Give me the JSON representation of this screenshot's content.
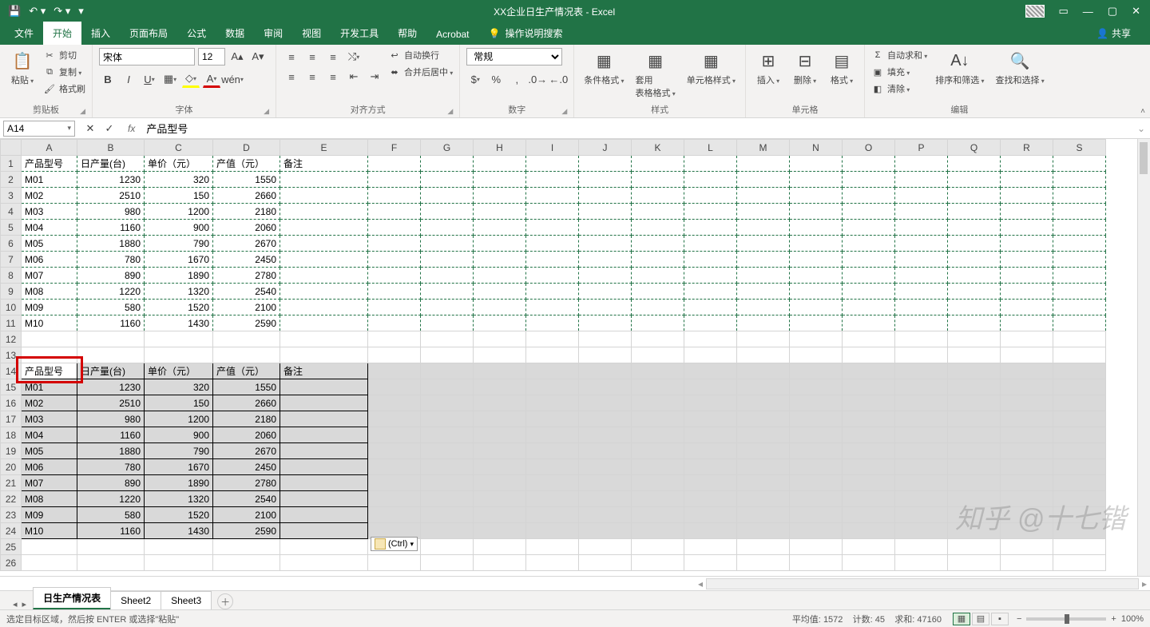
{
  "titlebar": {
    "title": "XX企业日生产情况表 - Excel",
    "qat": {
      "save": "💾",
      "undo_dd": "↶ ▾",
      "redo_dd": "↷ ▾",
      "more": "▾"
    },
    "win": {
      "ribbonopts": "▭",
      "min": "—",
      "max": "▢",
      "close": "✕"
    }
  },
  "tabs": {
    "file": "文件",
    "home": "开始",
    "insert": "插入",
    "layout": "页面布局",
    "formula": "公式",
    "data": "数据",
    "review": "审阅",
    "view": "视图",
    "dev": "开发工具",
    "help": "帮助",
    "acrobat": "Acrobat",
    "tellme": "操作说明搜索",
    "share": "共享"
  },
  "ribbon": {
    "clipboard": {
      "label": "剪贴板",
      "paste": "粘贴",
      "cut": "剪切",
      "copy": "复制",
      "fmtpainter": "格式刷"
    },
    "font": {
      "label": "字体",
      "name": "宋体",
      "size": "12"
    },
    "align": {
      "label": "对齐方式",
      "wrap": "自动换行",
      "merge": "合并后居中"
    },
    "number": {
      "label": "数字",
      "fmt": "常规"
    },
    "styles": {
      "label": "样式",
      "cond": "条件格式",
      "table": "套用\n表格格式",
      "cell": "单元格样式"
    },
    "cells": {
      "label": "单元格",
      "insert": "插入",
      "delete": "删除",
      "format": "格式"
    },
    "edit": {
      "label": "编辑",
      "sum": "自动求和",
      "fill": "填充",
      "clear": "清除",
      "sort": "排序和筛选",
      "find": "查找和选择"
    }
  },
  "formulabar": {
    "cell": "A14",
    "content": "产品型号"
  },
  "columns": [
    "A",
    "B",
    "C",
    "D",
    "E",
    "F",
    "G",
    "H",
    "I",
    "J",
    "K",
    "L",
    "M",
    "N",
    "O",
    "P",
    "Q",
    "R",
    "S"
  ],
  "widths": [
    70,
    84,
    86,
    84,
    110,
    66,
    66,
    66,
    66,
    66,
    66,
    66,
    66,
    66,
    66,
    66,
    66,
    66,
    66
  ],
  "headers": {
    "a": "产品型号",
    "b": "日产量(台)",
    "c": "单价（元）",
    "d": "产值（元）",
    "e": "备注"
  },
  "rows": [
    {
      "a": "M01",
      "b": 1230,
      "c": 320,
      "d": 1550
    },
    {
      "a": "M02",
      "b": 2510,
      "c": 150,
      "d": 2660
    },
    {
      "a": "M03",
      "b": 980,
      "c": 1200,
      "d": 2180
    },
    {
      "a": "M04",
      "b": 1160,
      "c": 900,
      "d": 2060
    },
    {
      "a": "M05",
      "b": 1880,
      "c": 790,
      "d": 2670
    },
    {
      "a": "M06",
      "b": 780,
      "c": 1670,
      "d": 2450
    },
    {
      "a": "M07",
      "b": 890,
      "c": 1890,
      "d": 2780
    },
    {
      "a": "M08",
      "b": 1220,
      "c": 1320,
      "d": 2540
    },
    {
      "a": "M09",
      "b": 580,
      "c": 1520,
      "d": 2100
    },
    {
      "a": "M10",
      "b": 1160,
      "c": 1430,
      "d": 2590
    }
  ],
  "pastetag": "(Ctrl)",
  "sheets": {
    "s1": "日生产情况表",
    "s2": "Sheet2",
    "s3": "Sheet3"
  },
  "status": {
    "mode": "选定目标区域，然后按 ENTER 或选择\"粘贴\"",
    "avg_l": "平均值:",
    "avg_v": "1572",
    "cnt_l": "计数:",
    "cnt_v": "45",
    "sum_l": "求和:",
    "sum_v": "47160",
    "zoom": "100%"
  },
  "watermark": "知乎 @十七锴"
}
